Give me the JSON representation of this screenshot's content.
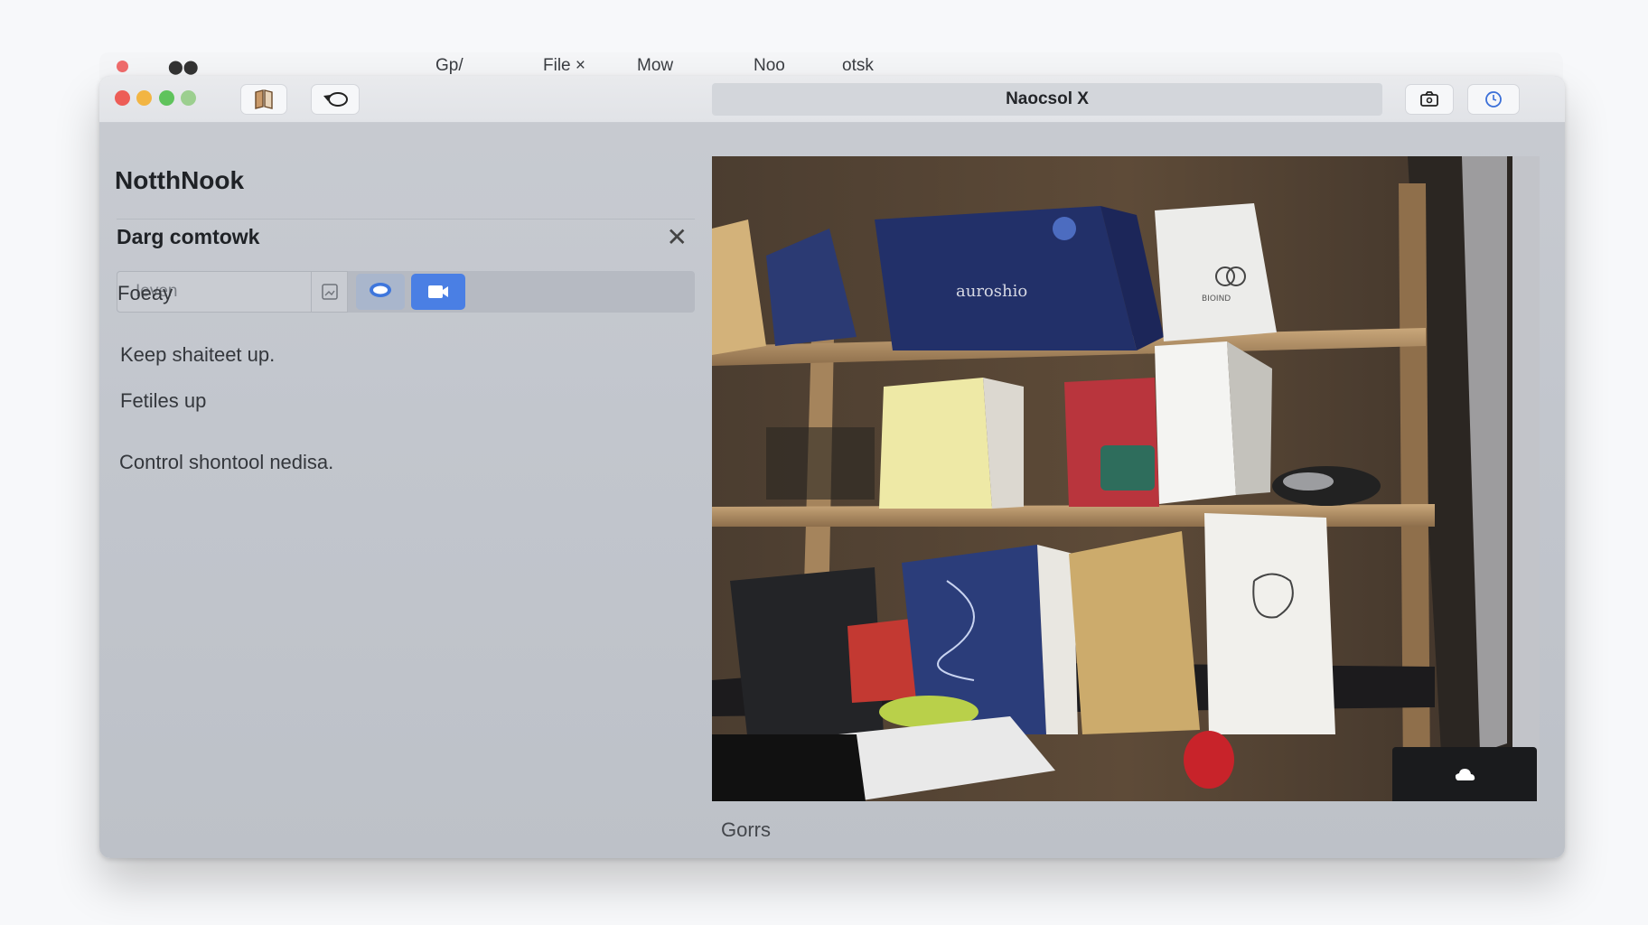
{
  "menubar": {
    "items": [
      "Gp/",
      "File ×",
      "Mow",
      "Noo",
      "otsk"
    ]
  },
  "titlebar": {
    "tab_title": "Naocsol X"
  },
  "sidebar": {
    "app_title": "NotthNook",
    "section_title": "Darg comtowk",
    "search": {
      "placeholder": "Ieven"
    },
    "labels": {
      "l1": "Foeay",
      "l2": "Keep shaiteet up.",
      "l3": "Fetiles up",
      "l4": "Control shontool nedisa."
    }
  },
  "media": {
    "caption": "Gorrs",
    "box_label_1": "auroshio",
    "box_label_2": "BIOIND"
  },
  "colors": {
    "accent": "#4a7fe4",
    "window_bg": "#c4c8ce"
  },
  "icons": [
    "book-icon",
    "undo-icon",
    "camera-icon",
    "clock-icon",
    "image-icon",
    "chat-icon",
    "video-icon",
    "close-icon",
    "cloud-icon"
  ]
}
